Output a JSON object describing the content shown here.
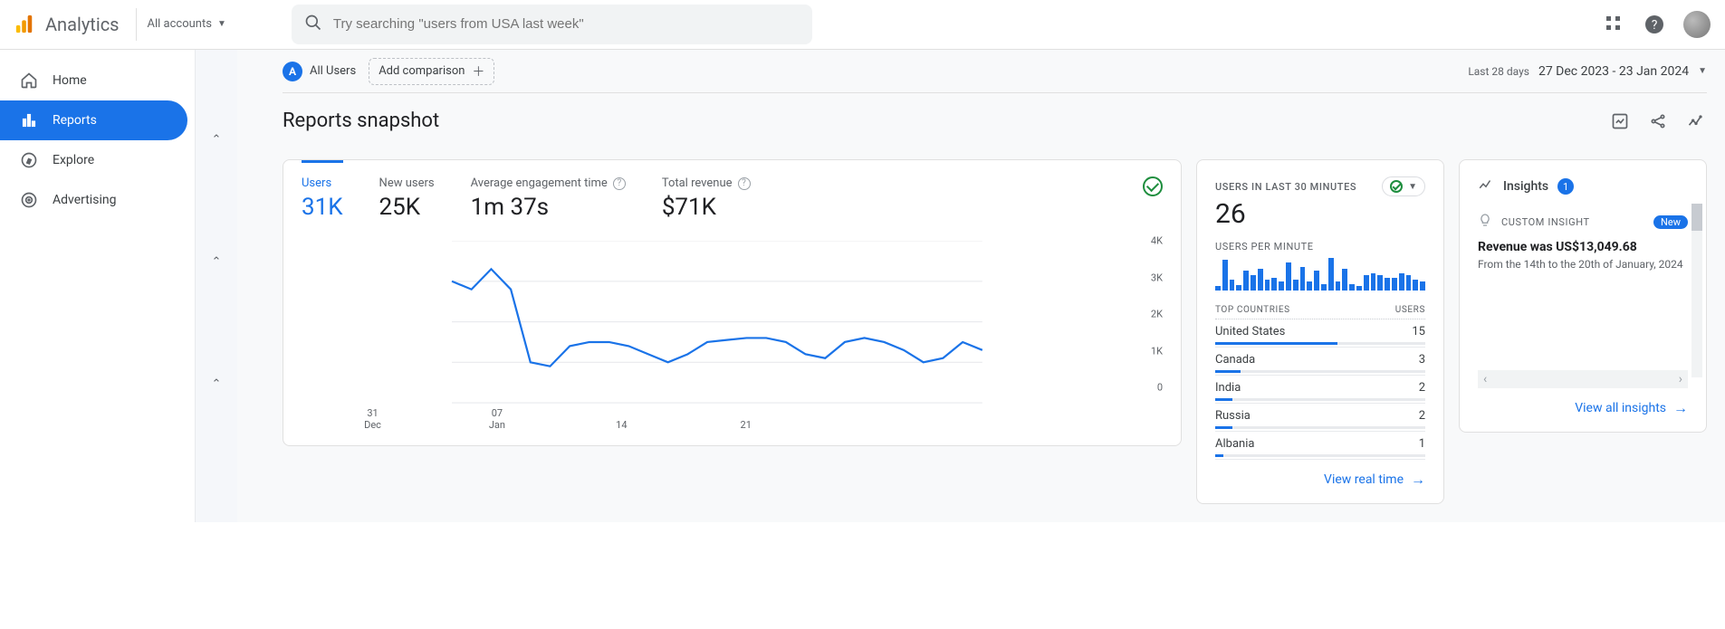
{
  "header": {
    "brand": "Analytics",
    "accounts_label": "All accounts",
    "search_placeholder": "Try searching \"users from USA last week\""
  },
  "sidebar": {
    "items": [
      {
        "label": "Home"
      },
      {
        "label": "Reports"
      },
      {
        "label": "Explore"
      },
      {
        "label": "Advertising"
      }
    ]
  },
  "filters": {
    "segment_letter": "A",
    "segment_label": "All Users",
    "add_comparison": "Add comparison",
    "date_label": "Last 28 days",
    "date_range": "27 Dec 2023 - 23 Jan 2024"
  },
  "page_title": "Reports snapshot",
  "overview": {
    "metrics": [
      {
        "label": "Users",
        "value": "31K"
      },
      {
        "label": "New users",
        "value": "25K"
      },
      {
        "label": "Average engagement time",
        "value": "1m 37s"
      },
      {
        "label": "Total revenue",
        "value": "$71K"
      }
    ]
  },
  "chart_data": {
    "type": "line",
    "title": "Users",
    "xlabel": "",
    "ylabel": "",
    "ylim": [
      0,
      4000
    ],
    "y_ticks": [
      0,
      1000,
      2000,
      3000,
      4000
    ],
    "y_tick_labels": [
      "0",
      "1K",
      "2K",
      "3K",
      "4K"
    ],
    "x_tick_labels": [
      "31 Dec",
      "07 Jan",
      "14",
      "21"
    ],
    "x": [
      "27 Dec",
      "28 Dec",
      "29 Dec",
      "30 Dec",
      "31 Dec",
      "01 Jan",
      "02 Jan",
      "03 Jan",
      "04 Jan",
      "05 Jan",
      "06 Jan",
      "07 Jan",
      "08 Jan",
      "09 Jan",
      "10 Jan",
      "11 Jan",
      "12 Jan",
      "13 Jan",
      "14 Jan",
      "15 Jan",
      "16 Jan",
      "17 Jan",
      "18 Jan",
      "19 Jan",
      "20 Jan",
      "21 Jan",
      "22 Jan",
      "23 Jan"
    ],
    "series": [
      {
        "name": "Users",
        "color": "#1a73e8",
        "values": [
          3000,
          2800,
          3300,
          2800,
          1000,
          900,
          1400,
          1500,
          1500,
          1400,
          1200,
          1000,
          1200,
          1500,
          1550,
          1600,
          1600,
          1500,
          1200,
          1100,
          1500,
          1600,
          1500,
          1300,
          1000,
          1100,
          1500,
          1300
        ]
      }
    ]
  },
  "realtime": {
    "title": "USERS IN LAST 30 MINUTES",
    "value": "26",
    "per_minute_label": "USERS PER MINUTE",
    "per_minute": [
      4,
      28,
      10,
      5,
      18,
      14,
      20,
      10,
      12,
      8,
      26,
      10,
      22,
      8,
      18,
      6,
      30,
      8,
      20,
      6,
      4,
      14,
      16,
      14,
      12,
      12,
      16,
      14,
      10,
      8
    ],
    "countries_header_left": "TOP COUNTRIES",
    "countries_header_right": "USERS",
    "countries": [
      {
        "name": "United States",
        "users": "15",
        "pct": 58
      },
      {
        "name": "Canada",
        "users": "3",
        "pct": 12
      },
      {
        "name": "India",
        "users": "2",
        "pct": 8
      },
      {
        "name": "Russia",
        "users": "2",
        "pct": 8
      },
      {
        "name": "Albania",
        "users": "1",
        "pct": 4
      }
    ],
    "link": "View real time"
  },
  "insights": {
    "title": "Insights",
    "count": "1",
    "sub_label": "CUSTOM INSIGHT",
    "new_badge": "New",
    "headline": "Revenue was US$13,049.68",
    "desc": "From the 14th to the 20th of January, 2024",
    "link": "View all insights"
  }
}
